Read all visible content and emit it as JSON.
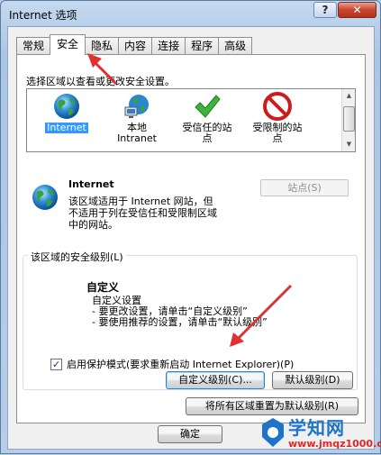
{
  "window": {
    "title": "Internet 选项",
    "help_label": "?",
    "close_label": "✕"
  },
  "tabs": [
    {
      "label": "常规"
    },
    {
      "label": "安全"
    },
    {
      "label": "隐私"
    },
    {
      "label": "内容"
    },
    {
      "label": "连接"
    },
    {
      "label": "程序"
    },
    {
      "label": "高级"
    }
  ],
  "active_tab": "安全",
  "security": {
    "instruction": "选择区域以查看或更改安全设置。",
    "zones": [
      {
        "label_line1": "Internet",
        "label_line2": "",
        "icon": "globe-icon",
        "selected": true
      },
      {
        "label_line1": "本地",
        "label_line2": "Intranet",
        "icon": "intranet-icon",
        "selected": false
      },
      {
        "label_line1": "受信任的站",
        "label_line2": "点",
        "icon": "check-icon",
        "selected": false
      },
      {
        "label_line1": "受限制的站",
        "label_line2": "点",
        "icon": "no-entry-icon",
        "selected": false
      }
    ],
    "selected_zone_name": "Internet",
    "sites_button": "站点(S)",
    "zone_description": [
      "该区域适用于 Internet 网站，但",
      "不适用于列在受信任和受限制区域",
      "中的网站。"
    ],
    "level_group_label": "该区域的安全级别(L)",
    "custom_title": "自定义",
    "custom_lines": [
      "自定义设置",
      "- 要更改设置，请单击“自定义级别”",
      "- 要使用推荐的设置，请单击“默认级别”"
    ],
    "protected_mode_label": "启用保护模式(要求重新启动 Internet Explorer)(P)",
    "protected_mode_checked": true,
    "custom_level_button": "自定义级别(C)...",
    "default_level_button": "默认级别(D)",
    "reset_all_button": "将所有区域重置为默认级别(R)"
  },
  "footer": {
    "ok_button": "确定"
  },
  "watermark": {
    "name": "学知网",
    "url": "www.jmqz1000.com"
  },
  "colors": {
    "selection": "#3399ff",
    "annotation_arrow": "#e03030"
  }
}
